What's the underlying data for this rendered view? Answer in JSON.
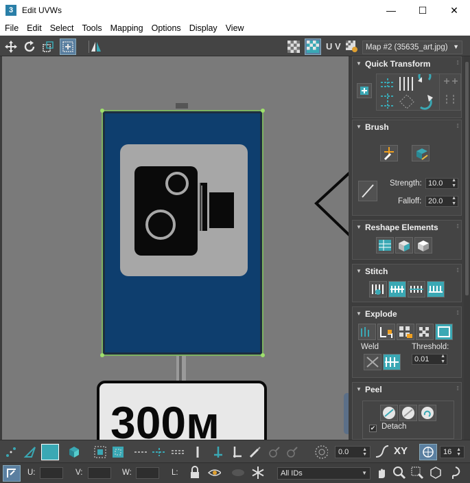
{
  "window": {
    "title": "Edit UVWs",
    "app_icon": "3",
    "minimize": "—",
    "maximize": "☐",
    "close": "✕"
  },
  "menu": [
    "File",
    "Edit",
    "Select",
    "Tools",
    "Mapping",
    "Options",
    "Display",
    "View"
  ],
  "toolbar": {
    "uv_label": "U V",
    "map_select": "Map #2 (35635_art.jpg)"
  },
  "viewport": {
    "sign_text": "300м"
  },
  "panel": {
    "quick_transform": {
      "title": "Quick Transform"
    },
    "brush": {
      "title": "Brush",
      "strength_label": "Strength:",
      "strength_value": "10.0",
      "falloff_label": "Falloff:",
      "falloff_value": "20.0"
    },
    "reshape": {
      "title": "Reshape Elements"
    },
    "stitch": {
      "title": "Stitch"
    },
    "explode": {
      "title": "Explode",
      "weld_label": "Weld",
      "threshold_label": "Threshold:",
      "threshold_value": "0.01"
    },
    "peel": {
      "title": "Peel",
      "detach_label": "Detach"
    }
  },
  "bottom1": {
    "angle_value": "0.0",
    "xy_label": "XY",
    "grid_value": "16"
  },
  "bottom2": {
    "u_label": "U:",
    "v_label": "V:",
    "w_label": "W:",
    "l_label": "L:",
    "ids_select": "All IDs"
  },
  "colors": {
    "accent": "#3aa8b4",
    "sign_blue": "#0e3e6e",
    "panel_bg": "#444444"
  }
}
